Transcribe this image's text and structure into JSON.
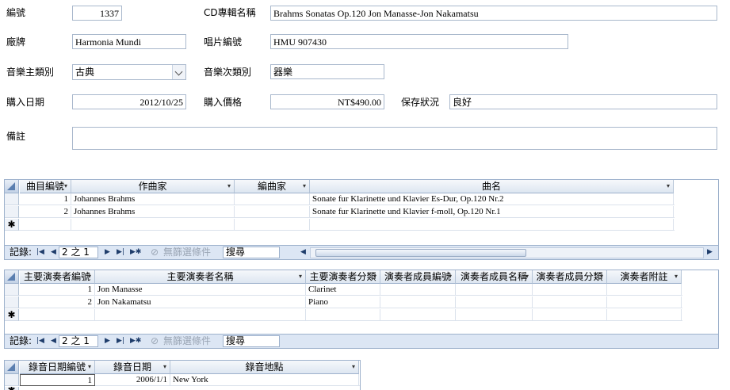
{
  "form": {
    "id_label": "編號",
    "id_value": "1337",
    "album_label": "CD專輯名稱",
    "album_value": "Brahms Sonatas Op.120 Jon Manasse-Jon Nakamatsu",
    "label_label": "廠牌",
    "label_value": "Harmonia Mundi",
    "catalog_label": "唱片編號",
    "catalog_value": "HMU 907430",
    "genre_label": "音樂主類別",
    "genre_value": "古典",
    "subgenre_label": "音樂次類別",
    "subgenre_value": "器樂",
    "date_label": "購入日期",
    "date_value": "2012/10/25",
    "price_label": "購入價格",
    "price_value": "NT$490.00",
    "condition_label": "保存狀況",
    "condition_value": "良好",
    "notes_label": "備註",
    "notes_value": ""
  },
  "tracks": {
    "headers": [
      "曲目編號",
      "作曲家",
      "編曲家",
      "曲名"
    ],
    "rows": [
      [
        "1",
        "Johannes Brahms",
        "",
        "Sonate fur Klarinette und Klavier Es-Dur, Op.120 Nr.2"
      ],
      [
        "2",
        "Johannes Brahms",
        "",
        "Sonate fur Klarinette und Klavier f-moll, Op.120 Nr.1"
      ]
    ],
    "new_row_marker": "✱",
    "nav": {
      "records_label": "記錄:",
      "position": "2 之 1",
      "filter": "無篩選條件",
      "search": "搜尋"
    }
  },
  "performers": {
    "headers": [
      "主要演奏者編號",
      "主要演奏者名稱",
      "主要演奏者分類",
      "演奏者成員編號",
      "演奏者成員名稱",
      "演奏者成員分類",
      "演奏者附註"
    ],
    "rows": [
      [
        "1",
        "Jon Manasse",
        "Clarinet",
        "",
        "",
        "",
        ""
      ],
      [
        "2",
        "Jon Nakamatsu",
        "Piano",
        "",
        "",
        "",
        ""
      ]
    ],
    "new_row_marker": "✱",
    "nav": {
      "records_label": "記錄:",
      "position": "2 之 1",
      "filter": "無篩選條件",
      "search": "搜尋"
    }
  },
  "recording": {
    "headers": [
      "錄音日期編號",
      "錄音日期",
      "錄音地點"
    ],
    "rows": [
      [
        "1",
        "2006/1/1",
        "New York"
      ]
    ],
    "new_row_marker": "✱"
  }
}
